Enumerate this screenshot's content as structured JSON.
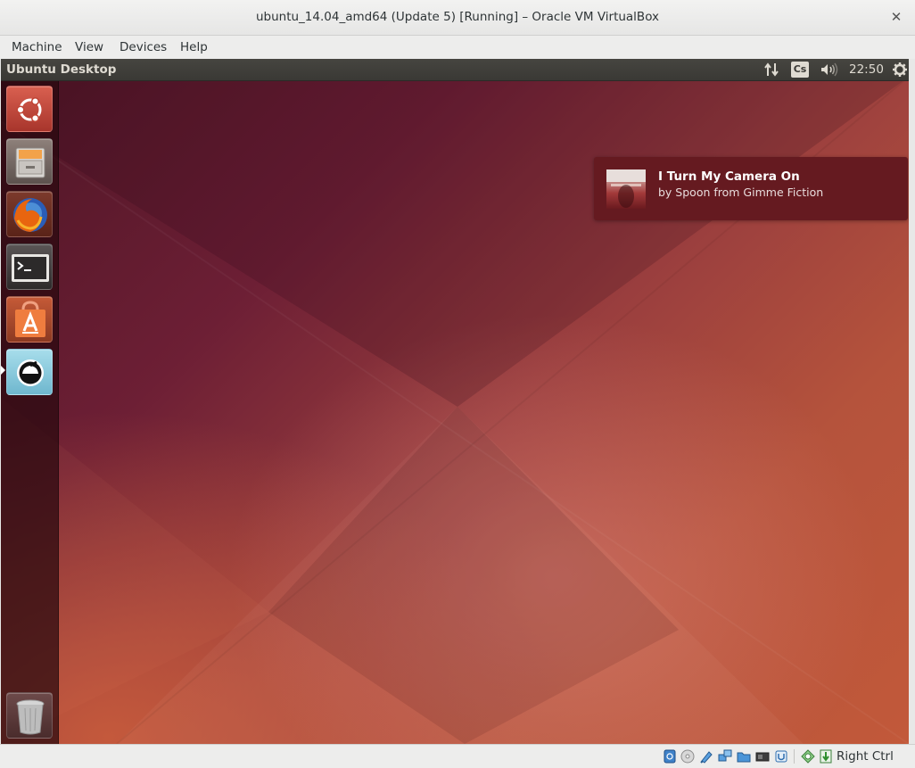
{
  "window": {
    "title": "ubuntu_14.04_amd64 (Update 5) [Running] – Oracle VM VirtualBox",
    "close_glyph": "✕"
  },
  "menubar": {
    "items": [
      {
        "label": "Machine"
      },
      {
        "label": "View"
      },
      {
        "label": "Devices"
      },
      {
        "label": "Help"
      }
    ]
  },
  "guest": {
    "panel": {
      "title": "Ubuntu Desktop",
      "keyboard_layout": "Cs",
      "clock": "22:50",
      "icons": [
        "network-updown-icon",
        "keyboard-layout-icon",
        "volume-icon",
        "session-gear-icon"
      ]
    },
    "launcher": {
      "items": [
        {
          "name": "dash-home",
          "icon": "ubuntu-logo-icon",
          "color": "#c44d3c"
        },
        {
          "name": "files",
          "icon": "file-cabinet-icon",
          "color": "#8a7b76"
        },
        {
          "name": "firefox",
          "icon": "firefox-icon",
          "color": "#e66b16"
        },
        {
          "name": "terminal",
          "icon": "terminal-icon",
          "color": "#3c3c3c"
        },
        {
          "name": "software-center",
          "icon": "shopping-bag-icon",
          "color": "#e8743b"
        },
        {
          "name": "music-player",
          "icon": "music-player-icon",
          "color": "#8fd1e6",
          "active": true
        },
        {
          "name": "trash",
          "icon": "trash-icon",
          "color": "#8c8c8c"
        }
      ]
    },
    "notification": {
      "title": "I Turn My Camera On",
      "body": "by Spoon from Gimme Fiction",
      "art_icon": "album-art-icon"
    },
    "colors": {
      "wallpaper_dark": "#4d1525",
      "wallpaper_warm": "#c2593a",
      "notification_bg": "#651a20",
      "panel_bg": "#3a3935"
    }
  },
  "statusbar": {
    "icons": [
      "hard-disk-icon",
      "optical-drive-icon",
      "usb-icon",
      "network-icon",
      "shared-folders-icon",
      "display-icon",
      "video-capture-icon",
      "mouse-integration-icon",
      "guest-additions-icon"
    ],
    "host_key": "Right Ctrl"
  }
}
